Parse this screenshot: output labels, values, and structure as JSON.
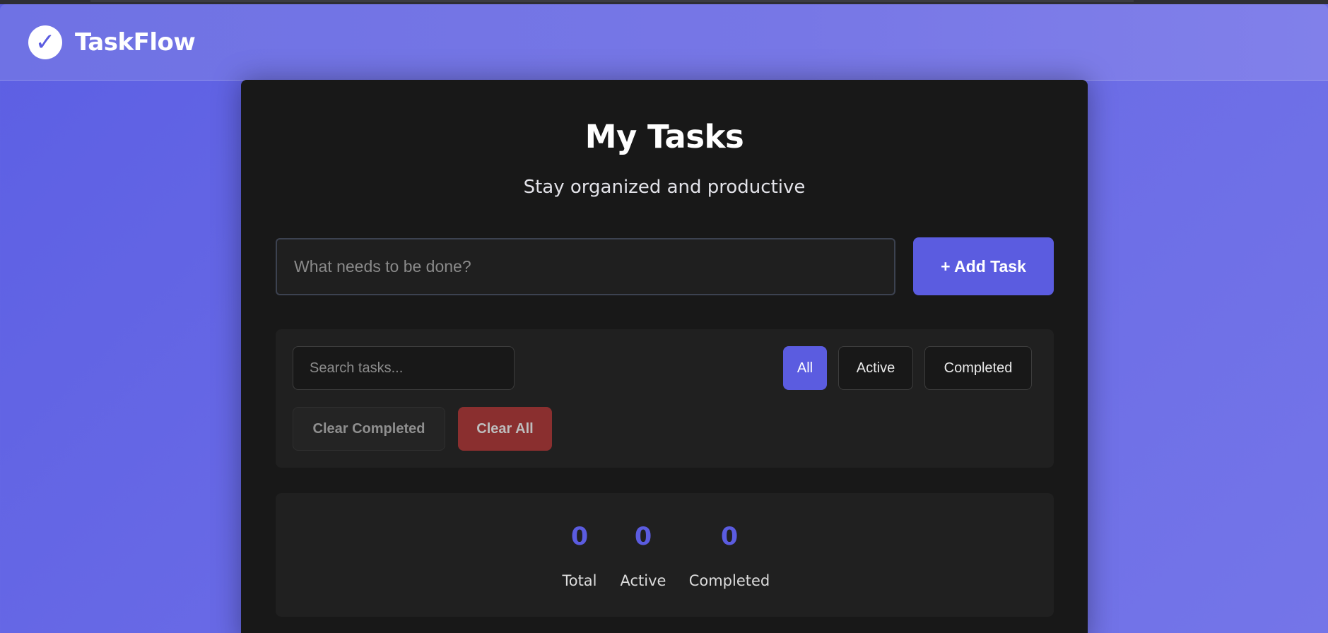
{
  "app": {
    "logo_glyph": "✓",
    "brand_name": "TaskFlow"
  },
  "colors": {
    "accent": "#5b5ce0",
    "background": "#6163e4",
    "card": "#181818",
    "danger": "#8a2f2f"
  },
  "header": {
    "title": "My Tasks",
    "subtitle": "Stay organized and productive"
  },
  "new_task": {
    "placeholder": "What needs to be done?",
    "value": "",
    "add_label": "+ Add Task"
  },
  "toolbar": {
    "search_placeholder": "Search tasks...",
    "search_value": "",
    "filters": [
      {
        "label": "All",
        "selected": true
      },
      {
        "label": "Active",
        "selected": false
      },
      {
        "label": "Completed",
        "selected": false
      }
    ],
    "clear_completed_label": "Clear Completed",
    "clear_all_label": "Clear All"
  },
  "stats": [
    {
      "value": "0",
      "label": "Total"
    },
    {
      "value": "0",
      "label": "Active"
    },
    {
      "value": "0",
      "label": "Completed"
    }
  ]
}
